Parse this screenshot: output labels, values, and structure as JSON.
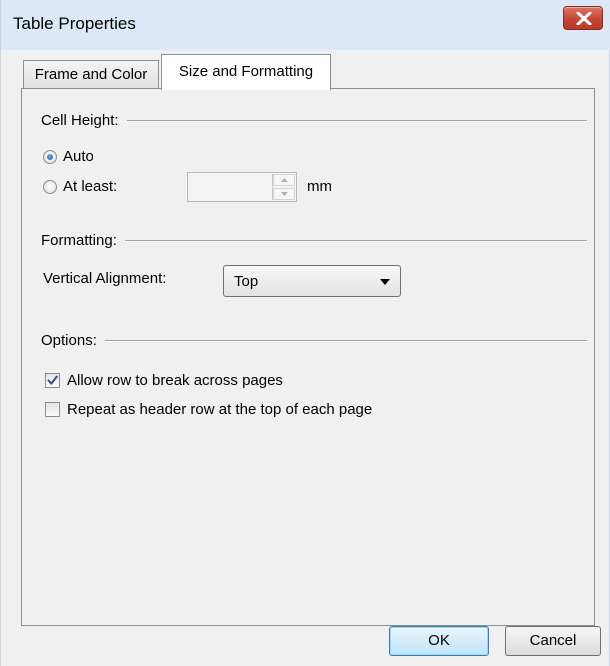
{
  "window": {
    "title": "Table Properties",
    "close_label": "Close"
  },
  "tabs": [
    {
      "label": "Frame and Color",
      "active": false
    },
    {
      "label": "Size and Formatting",
      "active": true
    }
  ],
  "cell_height": {
    "heading": "Cell Height:",
    "options": [
      {
        "label": "Auto",
        "checked": true
      },
      {
        "label": "At least:",
        "checked": false
      }
    ],
    "at_least_value": "",
    "unit": "mm"
  },
  "formatting": {
    "heading": "Formatting:",
    "vertical_alignment_label": "Vertical Alignment:",
    "vertical_alignment_value": "Top"
  },
  "options": {
    "heading": "Options:",
    "checkboxes": [
      {
        "label": "Allow row to break across pages",
        "checked": true
      },
      {
        "label": "Repeat as header row at the top of each page",
        "checked": false
      }
    ]
  },
  "buttons": {
    "ok": "OK",
    "cancel": "Cancel"
  },
  "colors": {
    "titlebar": "#dbe8f7",
    "close_button": "#c64535",
    "checkmark": "#2b4f8a",
    "radio_dot": "#1f5fb8"
  }
}
